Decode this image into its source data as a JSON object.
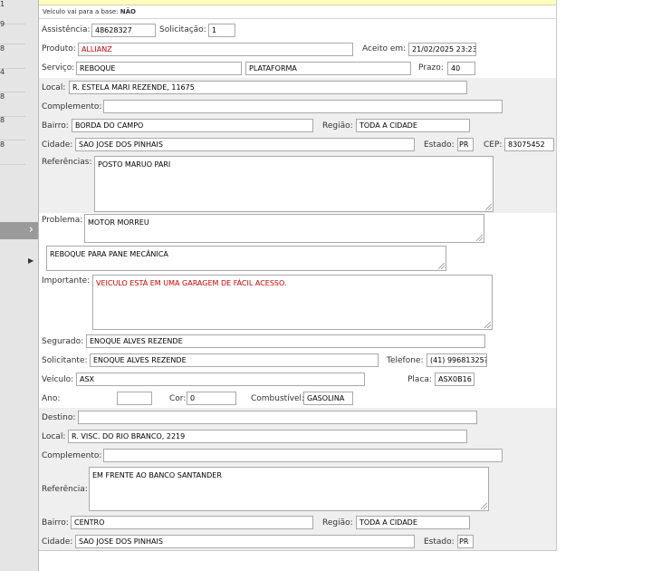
{
  "left_panel": {
    "numbers": [
      "1",
      "9",
      "8",
      "4",
      "8",
      "8",
      "8"
    ]
  },
  "info_bar": {
    "label": "Veículo vai para a base:",
    "value": "NÃO"
  },
  "labels": {
    "assistencia": "Assistência:",
    "solicitacao": "Solicitação:",
    "produto": "Produto:",
    "aceito_em": "Aceito em:",
    "servico": "Serviço:",
    "prazo": "Prazo:",
    "local": "Local:",
    "complemento": "Complemento:",
    "bairro": "Bairro:",
    "regiao": "Região:",
    "cidade": "Cidade:",
    "estado": "Estado:",
    "cep": "CEP:",
    "referencias": "Referências:",
    "problema": "Problema:",
    "importante": "Importante:",
    "segurado": "Segurado:",
    "solicitante": "Solicitante:",
    "telefone": "Telefone:",
    "veiculo": "Veículo:",
    "placa": "Placa:",
    "ano": "Ano:",
    "cor": "Cor:",
    "combustivel": "Combustível:",
    "destino": "Destino:",
    "referencia": "Referência:"
  },
  "origin": {
    "assistencia": "48628327",
    "solicitacao": "1",
    "produto": "ALLIANZ",
    "aceito_em": "21/02/2025 23:23",
    "servico": "REBOQUE",
    "servico_tipo": "PLATAFORMA",
    "prazo": "40",
    "local": "R. ESTELA MARI REZENDE, 11675",
    "complemento": "",
    "bairro": "BORDA DO CAMPO",
    "regiao": "TODA A CIDADE",
    "cidade": "SAO JOSE DOS PINHAIS",
    "estado": "PR",
    "cep": "83075452",
    "referencias": "POSTO MARUO PARI"
  },
  "problem": {
    "problema": "MOTOR MORREU",
    "descricao": "REBOQUE PARA PANE MECÂNICA",
    "importante": "VEICULO ESTÁ EM UMA GARAGEM DE FÁCIL ACESSO."
  },
  "vehicle": {
    "segurado": "ENOQUE ALVES REZENDE",
    "solicitante": "ENOQUE ALVES REZENDE",
    "telefone": "(41) 99681325?",
    "veiculo": "ASX",
    "placa": "ASX0B16",
    "ano": "",
    "cor": "0",
    "combustivel": "GASOLINA"
  },
  "destination": {
    "destino": "",
    "local": "R. VISC. DO RIO BRANCO, 2219",
    "complemento": "",
    "referencia": "EM FRENTE AO BANCO SANTANDER",
    "bairro": "CENTRO",
    "regiao": "TODA A CIDADE",
    "cidade": "SAO JOSE DOS PINHAIS",
    "estado": "PR"
  },
  "colors": {
    "highlight": "#cc0000",
    "info_bar": "#fffdc0",
    "section_shade": "#efefef"
  }
}
